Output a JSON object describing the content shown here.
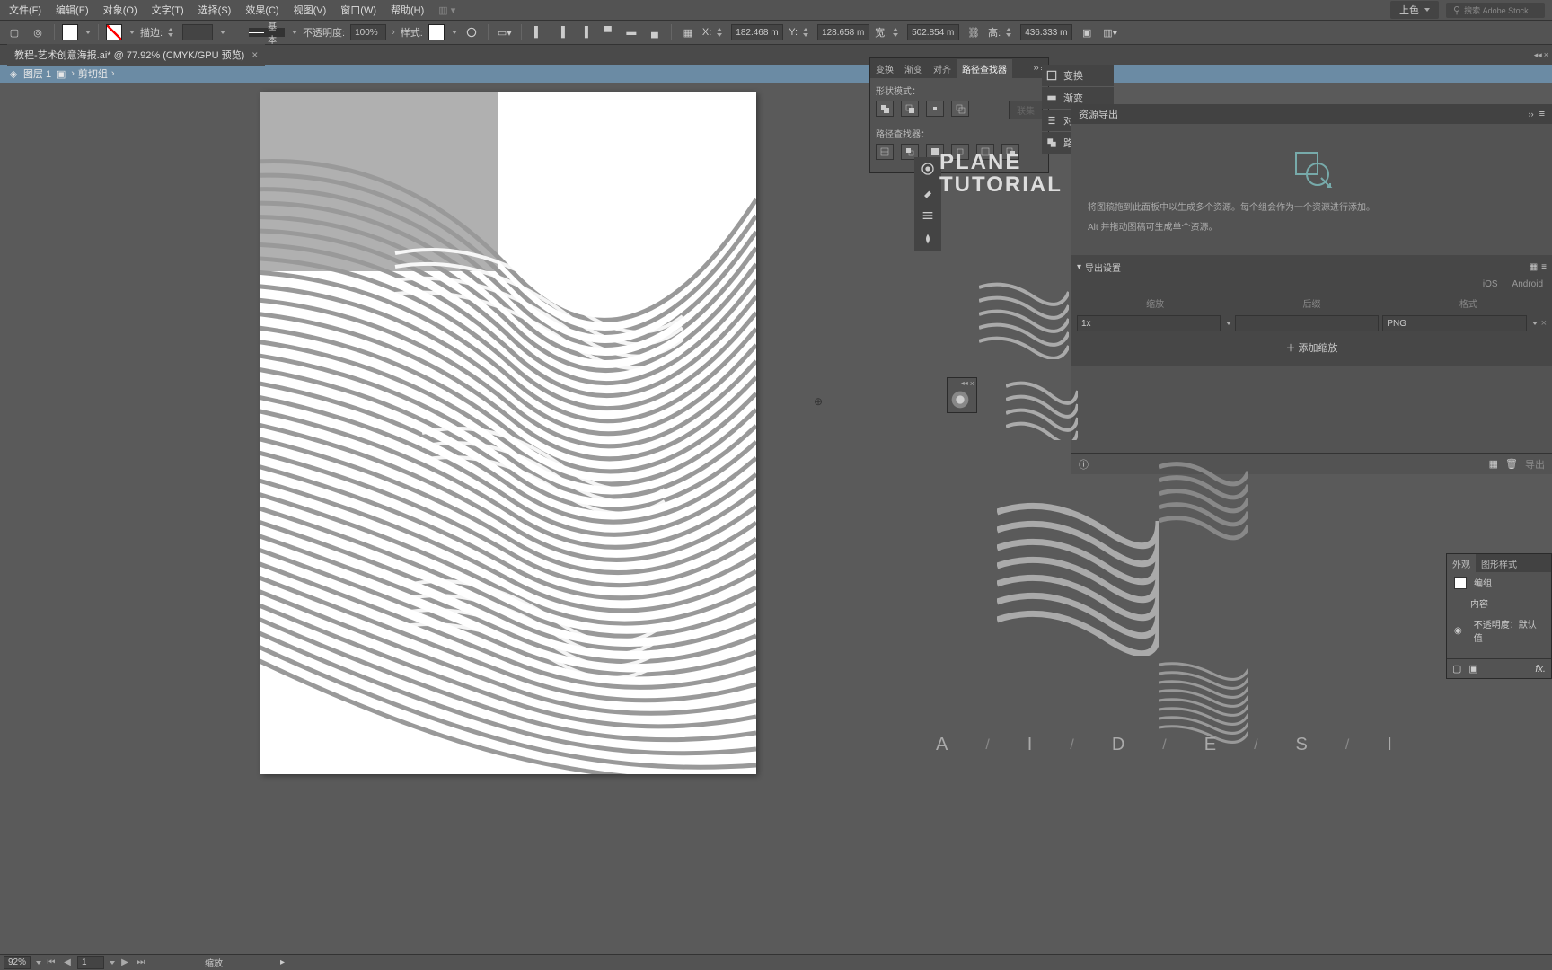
{
  "menu": {
    "file": "文件(F)",
    "edit": "编辑(E)",
    "object": "对象(O)",
    "type": "文字(T)",
    "select": "选择(S)",
    "effect": "效果(C)",
    "view": "视图(V)",
    "window": "窗口(W)",
    "help": "帮助(H)"
  },
  "top": {
    "color_mode": "上色",
    "stock_ph": "搜索 Adobe Stock"
  },
  "control": {
    "stroke_label": "描边:",
    "stroke_prev": "基本",
    "opacity_label": "不透明度:",
    "opacity": "100%",
    "style_label": "样式:",
    "x_label": "X:",
    "x": "182.468 m",
    "y_label": "Y:",
    "y": "128.658 m",
    "w_label": "宽:",
    "w": "502.854 m",
    "h_label": "高:",
    "h": "436.333 m"
  },
  "doc": {
    "title": "教程-艺术创意海报.ai* @ 77.92% (CMYK/GPU 预览)"
  },
  "breadcrumb": {
    "layer": "图层 1",
    "clip": "剪切组"
  },
  "pathfinder": {
    "t1": "变换",
    "t2": "渐变",
    "t3": "对齐",
    "t4": "路径查找器",
    "shape_modes": "形状模式：",
    "pathfinders": "路径查找器：",
    "expand": "联集"
  },
  "panel_tabs": {
    "transform": "变换",
    "gradient": "渐变",
    "align": "对齐",
    "pathfinder": "路径"
  },
  "export": {
    "title": "资源导出",
    "hint1": "将图稿拖到此面板中以生成多个资源。每个组会作为一个资源进行添加。",
    "hint2": "Alt 并拖动图稿可生成单个资源。",
    "settings": "导出设置",
    "ios": "iOS",
    "android": "Android",
    "col1": "缩放",
    "col2": "后缀",
    "col3": "格式",
    "scale": "1x",
    "format": "PNG",
    "add_scale": "添加缩放",
    "export_btn": "导出"
  },
  "tutorial": {
    "l1": "PLANE",
    "l2": "TUTORIAL"
  },
  "appearance": {
    "t1": "外观",
    "t2": "图形样式",
    "row1": "编组",
    "row2": "内容",
    "row3": "不透明度：默认值"
  },
  "letters": [
    "A",
    "I",
    "D",
    "E",
    "S",
    "I"
  ],
  "status": {
    "zoom": "92%",
    "artboard": "1",
    "tool": "缩放"
  }
}
